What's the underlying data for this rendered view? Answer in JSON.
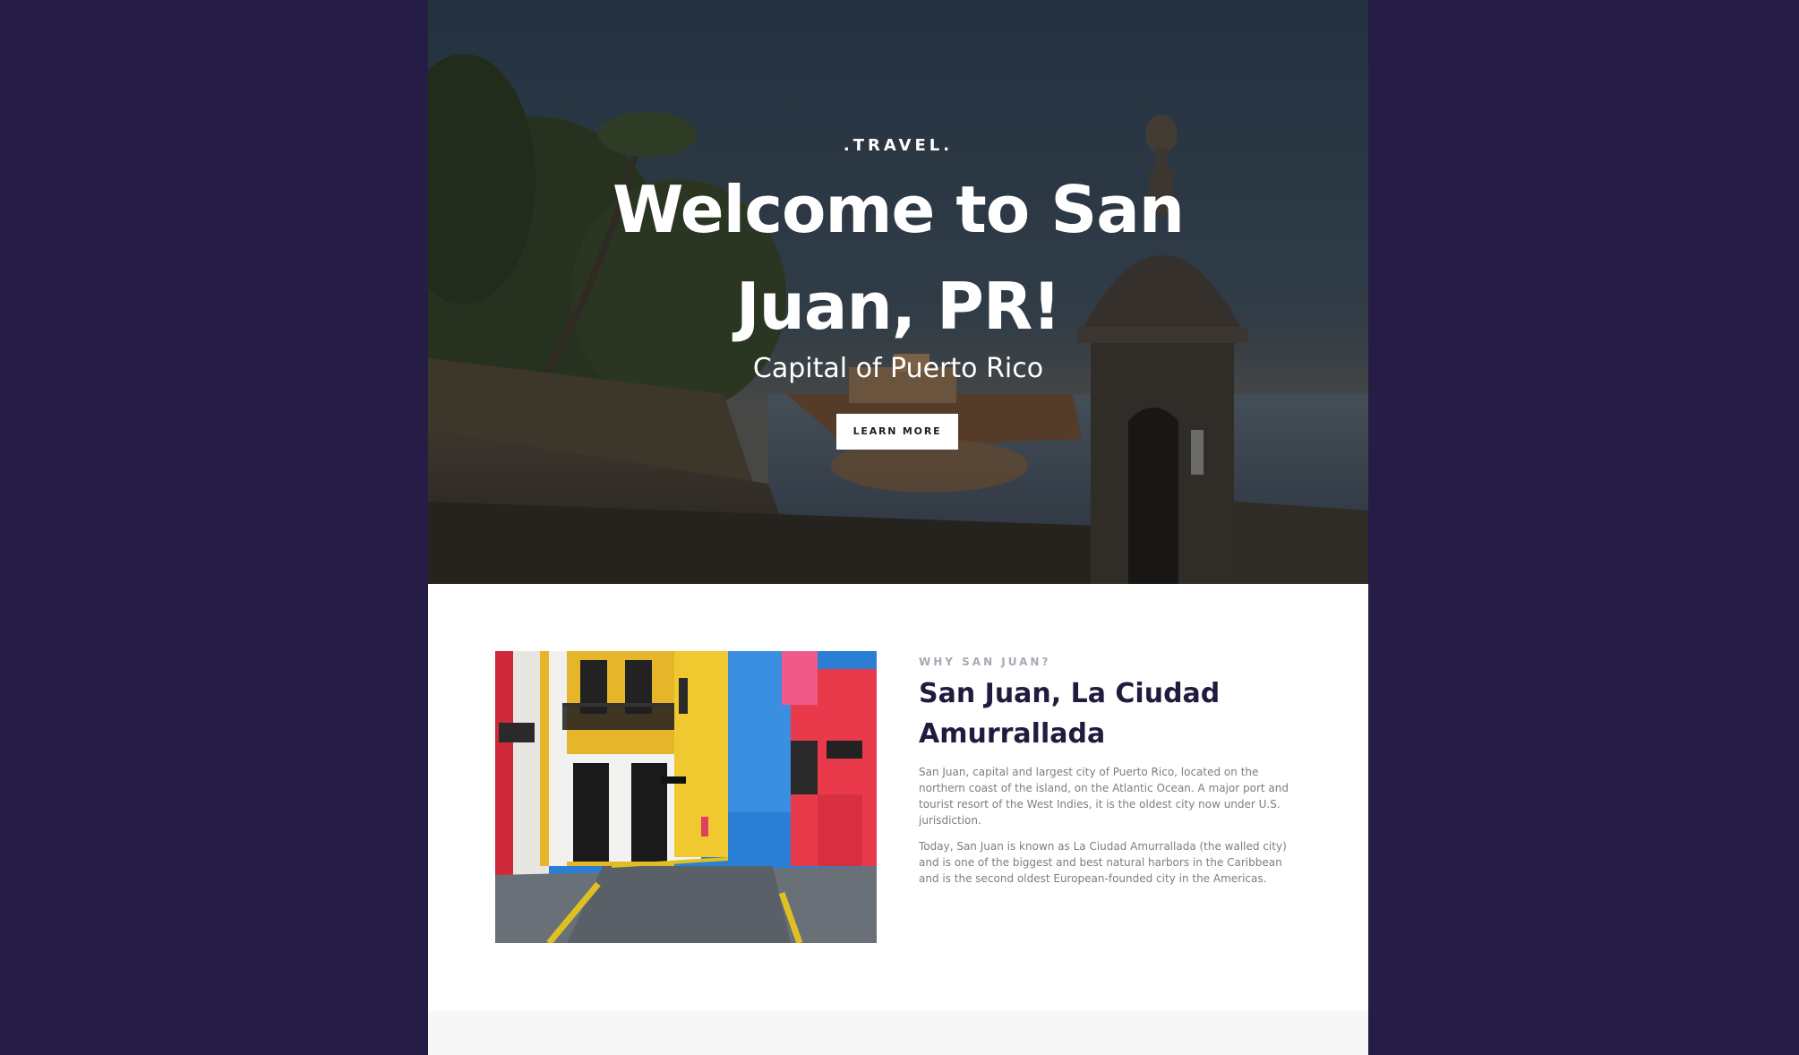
{
  "hero": {
    "eyebrow": ".TRAVEL.",
    "title": "Welcome to San Juan, PR!",
    "subtitle": "Capital of Puerto Rico",
    "button_label": "LEARN MORE"
  },
  "about": {
    "eyebrow": "WHY SAN JUAN?",
    "title": "San Juan, La Ciudad Amurrallada",
    "paragraphs": [
      "San Juan, capital and largest city of Puerto Rico, located on the northern coast of the island, on the Atlantic Ocean. A major port and tourist resort of the West Indies, it is the oldest city now under U.S. jurisdiction.",
      "Today, San Juan is known as La Ciudad Amurrallada (the walled city) and is one of the biggest and best natural harbors in the Caribbean and is the second oldest European-founded city in the Americas."
    ]
  },
  "colors": {
    "page_background": "#251d45",
    "heading": "#221b3f",
    "body_text": "#7c7d87",
    "eyebrow": "#a8a9b4"
  }
}
